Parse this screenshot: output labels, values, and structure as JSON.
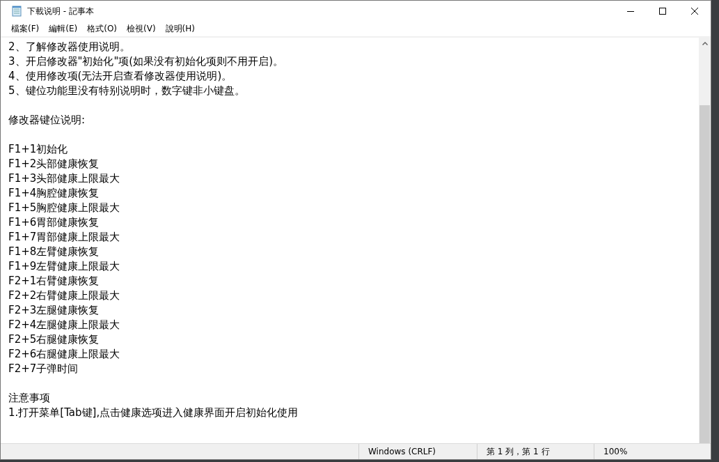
{
  "window": {
    "title": "下載说明 - 記事本"
  },
  "menu": [
    "檔案(F)",
    "編輯(E)",
    "格式(O)",
    "檢視(V)",
    "說明(H)"
  ],
  "document": {
    "paragraphs": [
      [
        "2、了解修改器使用说明。",
        "3、开启修改器\"初始化\"项(如果没有初始化项则不用开启)。",
        "4、使用修改项(无法开启查看修改器使用说明)。",
        "5、键位功能里没有特别说明时，数字键非小键盘。"
      ],
      [
        "修改器键位说明:"
      ],
      [
        "F1+1初始化",
        "F1+2头部健康恢复",
        "F1+3头部健康上限最大",
        "F1+4胸腔健康恢复",
        "F1+5胸腔健康上限最大",
        "F1+6胃部健康恢复",
        "F1+7胃部健康上限最大",
        "F1+8左臂健康恢复",
        "F1+9左臂健康上限最大",
        "F2+1右臂健康恢复",
        "F2+2右臂健康上限最大",
        "F2+3左腿健康恢复",
        "F2+4左腿健康上限最大",
        "F2+5右腿健康恢复",
        "F2+6右腿健康上限最大",
        "F2+7子弹时间"
      ],
      [
        "注意事项",
        "1.打开菜单[Tab键],点击健康选项进入健康界面开启初始化使用"
      ]
    ]
  },
  "status_bar": {
    "line_ending": "Windows (CRLF)",
    "position": "第 1 列，第 1 行",
    "zoom": "100%"
  }
}
